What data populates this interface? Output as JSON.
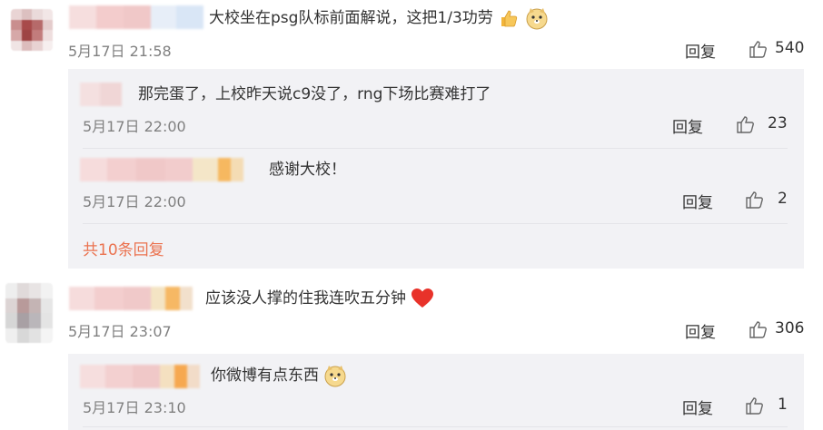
{
  "comments": [
    {
      "text": "大校坐在psg队标前面解说，这把1/3功劳",
      "emojis": [
        "thumbs-up-icon",
        "doge-icon"
      ],
      "time": "5月17日 21:58",
      "reply_label": "回复",
      "likes": "540"
    },
    {
      "text": "应该没人撑的住我连吹五分钟",
      "emojis": [
        "heart-icon"
      ],
      "time": "5月17日 23:07",
      "reply_label": "回复",
      "likes": "306"
    }
  ],
  "replies": [
    {
      "text": "那完蛋了，上校昨天说c9没了，rng下场比赛难打了",
      "time": "5月17日 22:00",
      "reply_label": "回复",
      "likes": "23"
    },
    {
      "text": "感谢大校！",
      "time": "5月17日 22:00",
      "reply_label": "回复",
      "likes": "2"
    },
    {
      "text": "你微博有点东西",
      "emojis": [
        "doge-icon"
      ],
      "time": "5月17日 23:10",
      "reply_label": "回复",
      "likes": "1"
    }
  ],
  "more_replies_label": "共10条回复",
  "colors": {
    "link": "#eb7350",
    "reply_bg": "#f2f2f5",
    "muted": "#808080"
  }
}
